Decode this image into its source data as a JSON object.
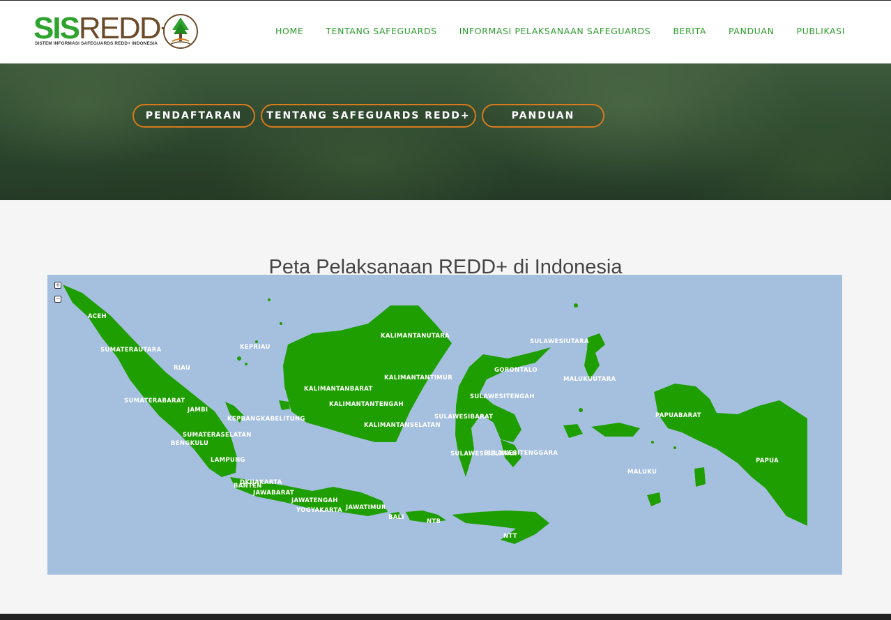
{
  "header": {
    "logo_text_a": "SIS",
    "logo_text_b": "REDD+",
    "logo_subtitle": "SISTEM INFORMASI SAFEGUARDS REDD+ INDONESIA",
    "nav": [
      {
        "label": "HOME"
      },
      {
        "label": "TENTANG SAFEGUARDS"
      },
      {
        "label": "INFORMASI PELAKSANAAN SAFEGUARDS"
      },
      {
        "label": "BERITA"
      },
      {
        "label": "PANDUAN"
      },
      {
        "label": "PUBLIKASI"
      }
    ]
  },
  "hero": {
    "buttons": [
      {
        "label": "PENDAFTARAN"
      },
      {
        "label": "TENTANG SAFEGUARDS REDD+"
      },
      {
        "label": "PANDUAN"
      }
    ]
  },
  "map": {
    "title": "Peta Pelaksanaan REDD+ di Indonesia",
    "zoom_in": "+",
    "zoom_out": "−",
    "colors": {
      "land": "#1e9e00",
      "sea": "#a5bfdf",
      "accent": "#d87a1d",
      "nav": "#2e9c2e"
    },
    "regions": [
      {
        "name": "ACEH"
      },
      {
        "name": "SUMATERAUTARA"
      },
      {
        "name": "RIAU"
      },
      {
        "name": "KEPRIAU"
      },
      {
        "name": "SUMATERABARAT"
      },
      {
        "name": "JAMBI"
      },
      {
        "name": "KEPBANGKABELITUNG"
      },
      {
        "name": "SUMATERASELATAN"
      },
      {
        "name": "BENGKULU"
      },
      {
        "name": "LAMPUNG"
      },
      {
        "name": "DKIJAKARTA"
      },
      {
        "name": "BANTEN"
      },
      {
        "name": "JAWABARAT"
      },
      {
        "name": "JAWATENGAH"
      },
      {
        "name": "YOGYAKARTA"
      },
      {
        "name": "JAWATIMUR"
      },
      {
        "name": "BALI"
      },
      {
        "name": "NTB"
      },
      {
        "name": "NTT"
      },
      {
        "name": "KALIMANTANUTARA"
      },
      {
        "name": "KALIMANTANTIMUR"
      },
      {
        "name": "KALIMANTANBARAT"
      },
      {
        "name": "KALIMANTANTENGAH"
      },
      {
        "name": "KALIMANTANSELATAN"
      },
      {
        "name": "SULAWESIUTARA"
      },
      {
        "name": "GORONTALO"
      },
      {
        "name": "SULAWESITENGAH"
      },
      {
        "name": "SULAWESIBARAT"
      },
      {
        "name": "SULAWESISELATAN"
      },
      {
        "name": "SULAWESITENGGARA"
      },
      {
        "name": "MALUKUUTARA"
      },
      {
        "name": "MALUKU"
      },
      {
        "name": "PAPUABARAT"
      },
      {
        "name": "PAPUA"
      }
    ]
  }
}
